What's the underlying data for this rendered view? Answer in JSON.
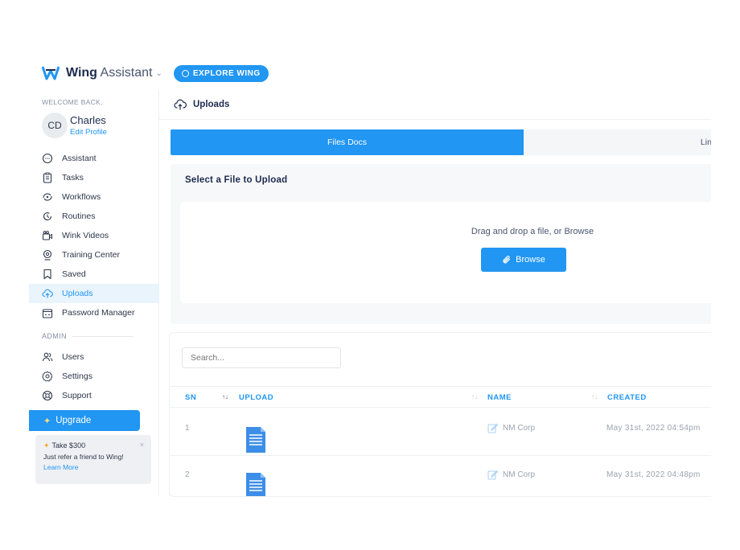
{
  "topbar": {
    "brand_bold": "Wing",
    "brand_light": "Assistant",
    "brand_chevron": "⌄",
    "explore_label": "EXPLORE WING"
  },
  "sidebar": {
    "welcome": "WELCOME BACK,",
    "avatar_initials": "CD",
    "user_name": "Charles",
    "edit_profile": "Edit Profile",
    "items": [
      {
        "label": "Assistant",
        "icon": "chat-icon"
      },
      {
        "label": "Tasks",
        "icon": "clipboard-icon"
      },
      {
        "label": "Workflows",
        "icon": "workflow-icon"
      },
      {
        "label": "Routines",
        "icon": "routine-icon"
      },
      {
        "label": "Wink Videos",
        "icon": "video-icon"
      },
      {
        "label": "Training Center",
        "icon": "training-icon"
      },
      {
        "label": "Saved",
        "icon": "bookmark-icon"
      },
      {
        "label": "Uploads",
        "icon": "cloud-upload-icon",
        "active": true
      },
      {
        "label": "Password Manager",
        "icon": "password-icon"
      }
    ],
    "admin_label": "ADMIN",
    "admin_items": [
      {
        "label": "Users",
        "icon": "users-icon"
      },
      {
        "label": "Settings",
        "icon": "settings-icon"
      },
      {
        "label": "Support",
        "icon": "support-icon"
      }
    ],
    "upgrade_label": "Upgrade",
    "promo": {
      "title": "Take $300",
      "body": "Just refer a friend to Wing!",
      "link": "Learn More",
      "close": "×"
    }
  },
  "main": {
    "header_title": "Uploads",
    "tabs": [
      {
        "label": "Files Docs",
        "active": true
      },
      {
        "label": "Link Te",
        "active": false
      }
    ],
    "upload_card": {
      "title": "Select a File to Upload",
      "dropzone_text": "Drag and drop a file, or Browse",
      "browse_label": "Browse"
    },
    "list": {
      "search_placeholder": "Search...",
      "columns": {
        "sn": "SN",
        "upload": "UPLOAD",
        "name": "NAME",
        "created": "CREATED"
      },
      "rows": [
        {
          "sn": "1",
          "name": "NM Corp",
          "created": "May 31st, 2022 04:54pm"
        },
        {
          "sn": "2",
          "name": "NM Corp",
          "created": "May 31st, 2022 04:48pm"
        }
      ]
    }
  },
  "colors": {
    "accent": "#2196f3",
    "brand_dark": "#1d2b4f"
  }
}
